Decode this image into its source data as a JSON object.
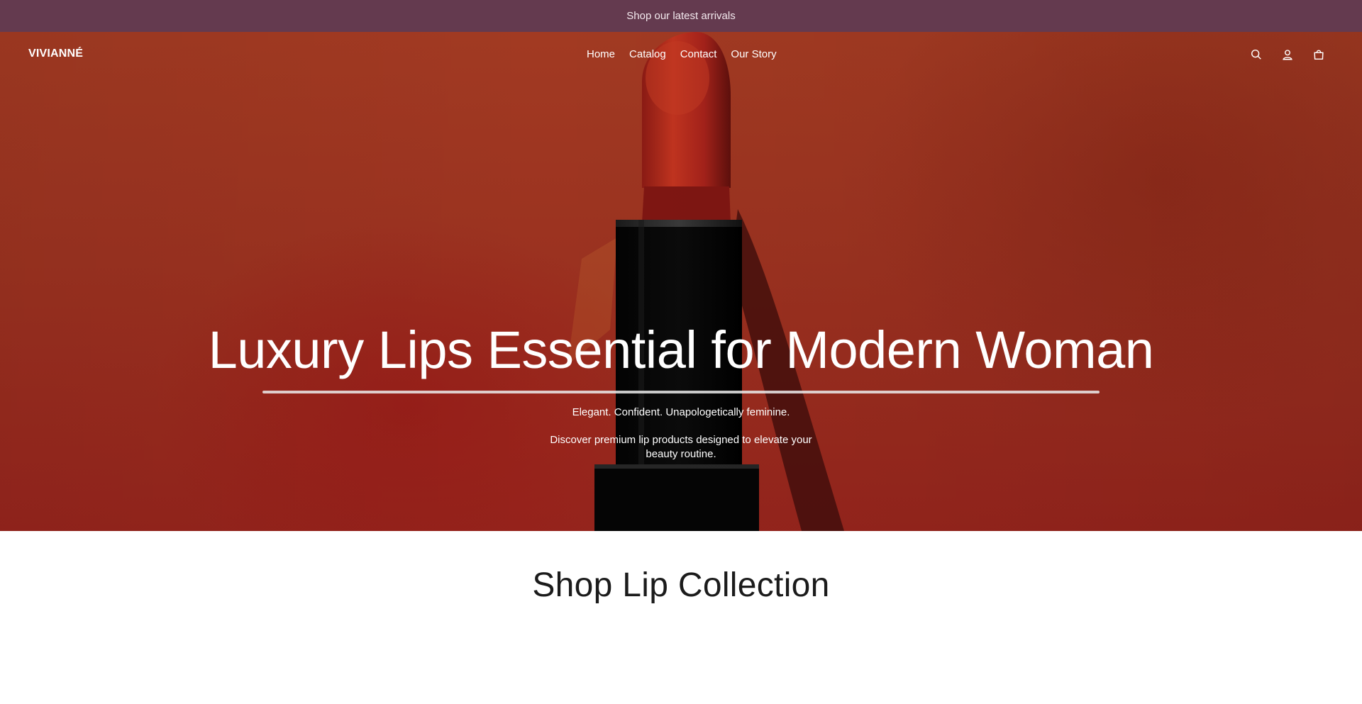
{
  "announcement": {
    "text": "Shop our latest arrivals"
  },
  "header": {
    "logo": "VIVIANNÉ",
    "nav": [
      {
        "label": "Home"
      },
      {
        "label": "Catalog"
      },
      {
        "label": "Contact"
      },
      {
        "label": "Our Story"
      }
    ],
    "icons": [
      "search-icon",
      "account-icon",
      "cart-icon"
    ]
  },
  "hero": {
    "title": "Luxury Lips Essential for Modern Woman",
    "tagline": "Elegant. Confident. Unapologetically feminine.",
    "description": "Discover premium lip products designed to elevate your beauty routine."
  },
  "collection": {
    "title": "Shop Lip Collection"
  },
  "colors": {
    "announcement_bg": "#643a4f",
    "hero_bg": "#9b3220",
    "lipstick_red": "#b0271e",
    "case_black": "#050505"
  }
}
